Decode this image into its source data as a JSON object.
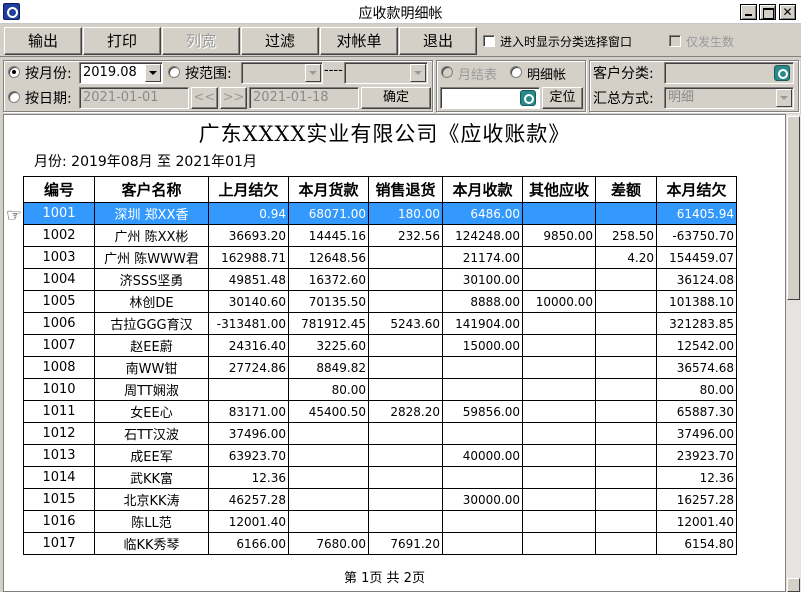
{
  "window": {
    "title": "应收款明细帐"
  },
  "toolbar": {
    "buttons": [
      {
        "label": "输出",
        "enabled": true
      },
      {
        "label": "打印",
        "enabled": true
      },
      {
        "label": "列宽",
        "enabled": false
      },
      {
        "label": "过滤",
        "enabled": true
      },
      {
        "label": "对帐单",
        "enabled": true
      },
      {
        "label": "退出",
        "enabled": true
      }
    ],
    "show_category_label": "进入时显示分类选择窗口",
    "only_occurred_label": "仅发生数"
  },
  "filter": {
    "by_month_label": "按月份:",
    "month_value": "2019.08",
    "by_range_label": "按范围:",
    "range_sep": "----",
    "by_date_label": "按日期:",
    "date_from": "2021-01-01",
    "date_to": "2021-01-18",
    "prev_label": "<<",
    "next_label": ">>",
    "confirm_label": "确定",
    "monthly_balance_label": "月结表",
    "detail_label": "明细帐",
    "locate_label": "定位",
    "customer_category_label": "客户分类:",
    "summary_mode_label": "汇总方式:",
    "summary_mode_value": "明细"
  },
  "report": {
    "title": "广东XXXX实业有限公司《应收账款》",
    "period": "月份:  2019年08月 至 2021年01月",
    "pager": "第 1页   共 2页",
    "columns": [
      "编号",
      "客户名称",
      "上月结欠",
      "本月货款",
      "销售退货",
      "本月收款",
      "其他应收",
      "差额",
      "本月结欠"
    ],
    "rows": [
      [
        "1001",
        "深圳 郑XX香",
        "0.94",
        "68071.00",
        "180.00",
        "6486.00",
        "",
        "",
        "61405.94"
      ],
      [
        "1002",
        "广州 陈XX彬",
        "36693.20",
        "14445.16",
        "232.56",
        "124248.00",
        "9850.00",
        "258.50",
        "-63750.70"
      ],
      [
        "1003",
        "广州 陈WWW君",
        "162988.71",
        "12648.56",
        "",
        "21174.00",
        "",
        "4.20",
        "154459.07"
      ],
      [
        "1004",
        "济SSS坚勇",
        "49851.48",
        "16372.60",
        "",
        "30100.00",
        "",
        "",
        "36124.08"
      ],
      [
        "1005",
        "林创DE",
        "30140.60",
        "70135.50",
        "",
        "8888.00",
        "10000.00",
        "",
        "101388.10"
      ],
      [
        "1006",
        "古拉GGG育汉",
        "-313481.00",
        "781912.45",
        "5243.60",
        "141904.00",
        "",
        "",
        "321283.85"
      ],
      [
        "1007",
        "赵EE蔚",
        "24316.40",
        "3225.60",
        "",
        "15000.00",
        "",
        "",
        "12542.00"
      ],
      [
        "1008",
        "南WW钳",
        "27724.86",
        "8849.82",
        "",
        "",
        "",
        "",
        "36574.68"
      ],
      [
        "1010",
        "周TT娴淑",
        "",
        "80.00",
        "",
        "",
        "",
        "",
        "80.00"
      ],
      [
        "1011",
        "女EE心",
        "83171.00",
        "45400.50",
        "2828.20",
        "59856.00",
        "",
        "",
        "65887.30"
      ],
      [
        "1012",
        "石TT汉波",
        "37496.00",
        "",
        "",
        "",
        "",
        "",
        "37496.00"
      ],
      [
        "1013",
        "成EE军",
        "63923.70",
        "",
        "",
        "40000.00",
        "",
        "",
        "23923.70"
      ],
      [
        "1014",
        "武KK富",
        "12.36",
        "",
        "",
        "",
        "",
        "",
        "12.36"
      ],
      [
        "1015",
        "北京KK涛",
        "46257.28",
        "",
        "",
        "30000.00",
        "",
        "",
        "16257.28"
      ],
      [
        "1016",
        "陈LL范",
        "12001.40",
        "",
        "",
        "",
        "",
        "",
        "12001.40"
      ],
      [
        "1017",
        "临KK秀琴",
        "6166.00",
        "7680.00",
        "7691.20",
        "",
        "",
        "",
        "6154.80"
      ]
    ],
    "selected_row": 0,
    "pointer_glyph": "☞"
  },
  "colors": {
    "selection": "#3399ff",
    "chrome": "#d4d0c8"
  }
}
